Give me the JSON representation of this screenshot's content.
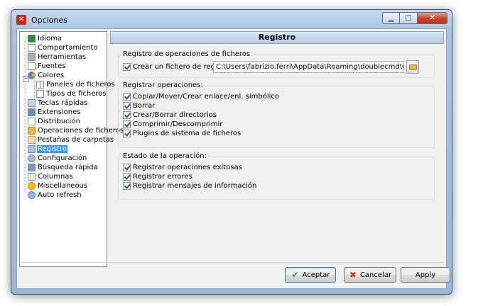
{
  "window": {
    "title": "Opciones"
  },
  "tree": {
    "items": [
      {
        "label": "Idioma",
        "icon": "flag-icon",
        "color": "#2d8a3b"
      },
      {
        "label": "Comportamiento",
        "icon": "document-icon",
        "color": "#ffffff"
      },
      {
        "label": "Herramientas",
        "icon": "tools-icon",
        "color": "#8a8a8a"
      },
      {
        "label": "Fuentes",
        "icon": "font-icon",
        "color": "#ffffff"
      },
      {
        "label": "Colores",
        "icon": "color-wheel-icon",
        "color": "#e84a8a"
      },
      {
        "label": "Paneles de ficheros",
        "icon": "panels-icon",
        "color": "#ffffff"
      },
      {
        "label": "Tipos de ficheros",
        "icon": "document-icon",
        "color": "#ffffff"
      },
      {
        "label": "Teclas rápidas",
        "icon": "keyboard-icon",
        "color": "#6a86a8"
      },
      {
        "label": "Extensiones",
        "icon": "plugin-icon",
        "color": "#4a6fa0"
      },
      {
        "label": "Distribución",
        "icon": "layout-icon",
        "color": "#ffffff"
      },
      {
        "label": "Operaciones de ficheros",
        "icon": "folder-icon",
        "color": "#e8b94a"
      },
      {
        "label": "Pestañas de carpetas",
        "icon": "folder-tabs-icon",
        "color": "#e8d8a8"
      },
      {
        "label": "Registro",
        "icon": "log-icon",
        "color": "#6aa0d8"
      },
      {
        "label": "Configuración",
        "icon": "gear-icon",
        "color": "#6a86a8"
      },
      {
        "label": "Búsqueda rápida",
        "icon": "search-icon",
        "color": "#4a6fa0"
      },
      {
        "label": "Columnas",
        "icon": "columns-icon",
        "color": "#ffffff"
      },
      {
        "label": "Miscellaneous",
        "icon": "smiley-icon",
        "color": "#f0c020"
      },
      {
        "label": "Auto refresh",
        "icon": "refresh-icon",
        "color": "#4a8ad0"
      }
    ]
  },
  "panel": {
    "title": "Registro",
    "group_file_log": {
      "title": "Registro de operaciones de ficheros",
      "create_log_label": "Crear un fichero de registro:",
      "log_path": "C:\\Users\\fabrizio.ferri\\AppData\\Roaming\\doublecmd\\doublecmd.lo"
    },
    "group_operations": {
      "title": "Registrar operaciones:",
      "items": [
        "Copiar/Mover/Crear enlace/enl. simbólico",
        "Borrar",
        "Crear/Borrar directorios",
        "Comprimir/Descomprimir",
        "Plugins de sistema de ficheros"
      ]
    },
    "group_status": {
      "title": "Estado de la operación:",
      "items": [
        "Registrar operaciones exitosas",
        "Registrar errores",
        "Registrar mensajes de información"
      ]
    }
  },
  "buttons": {
    "accept": "Aceptar",
    "cancel": "Cancelar",
    "apply": "Apply"
  }
}
